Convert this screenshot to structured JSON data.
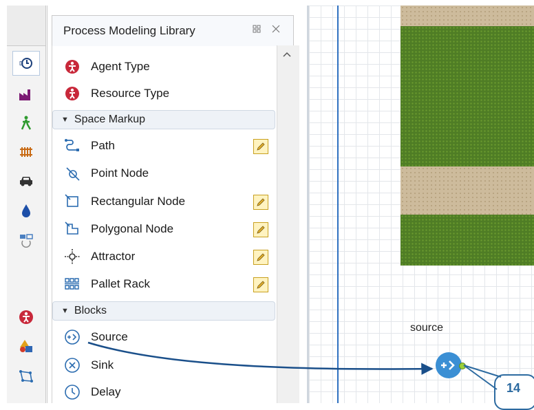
{
  "panel": {
    "title": "Process Modeling Library",
    "header_icons": [
      "restore-icon",
      "close-tab-icon"
    ]
  },
  "palette_strip": [
    {
      "icon": "process-library-icon",
      "active": true
    },
    {
      "icon": "factory-icon"
    },
    {
      "icon": "pedestrian-icon"
    },
    {
      "icon": "rail-icon"
    },
    {
      "icon": "car-icon"
    },
    {
      "icon": "fluid-drop-icon"
    },
    {
      "icon": "motion-icon"
    },
    {
      "icon": "agent-icon"
    },
    {
      "icon": "shapes-icon"
    },
    {
      "icon": "markup-icon"
    }
  ],
  "library": {
    "top_items": [
      {
        "label": "Agent Type",
        "icon": "agent-type-icon"
      },
      {
        "label": "Resource Type",
        "icon": "resource-type-icon"
      }
    ],
    "sections": [
      {
        "label": "Space Markup",
        "items": [
          {
            "label": "Path",
            "icon": "path-icon",
            "editable": true
          },
          {
            "label": "Point Node",
            "icon": "point-node-icon",
            "editable": false
          },
          {
            "label": "Rectangular Node",
            "icon": "rectangular-node-icon",
            "editable": true
          },
          {
            "label": "Polygonal Node",
            "icon": "polygonal-node-icon",
            "editable": true
          },
          {
            "label": "Attractor",
            "icon": "attractor-icon",
            "editable": true
          },
          {
            "label": "Pallet Rack",
            "icon": "pallet-rack-icon",
            "editable": true
          }
        ]
      },
      {
        "label": "Blocks",
        "items": [
          {
            "label": "Source",
            "icon": "source-icon"
          },
          {
            "label": "Sink",
            "icon": "sink-icon"
          },
          {
            "label": "Delay",
            "icon": "delay-icon"
          }
        ]
      }
    ]
  },
  "canvas": {
    "source_label": "source",
    "callout_number": "14"
  },
  "colors": {
    "accent_blue": "#3b8fd4",
    "grass": "#4f7d25",
    "sand": "#cdbb9c",
    "callout": "#2c6aa0"
  }
}
